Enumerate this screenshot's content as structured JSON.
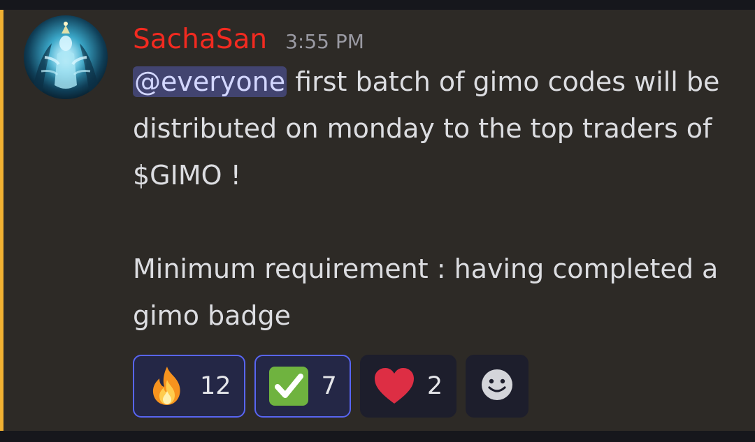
{
  "message": {
    "author": "SachaSan",
    "timestamp": "3:55 PM",
    "author_color": "#f22a20",
    "highlight_color": "#f0b132",
    "mention": "@everyone",
    "line1_rest": " first batch of gimo codes will be distributed on monday to the top traders of $GIMO !",
    "paragraph2": "Minimum requirement : having completed a gimo badge"
  },
  "reactions": [
    {
      "icon": "fire-emoji-icon",
      "count": "12",
      "selected": true
    },
    {
      "icon": "check-mark-emoji-icon",
      "count": "7",
      "selected": true
    },
    {
      "icon": "red-heart-emoji-icon",
      "count": "2",
      "selected": false
    }
  ],
  "add_reaction": {
    "icon": "smiley-add-reaction-icon"
  }
}
